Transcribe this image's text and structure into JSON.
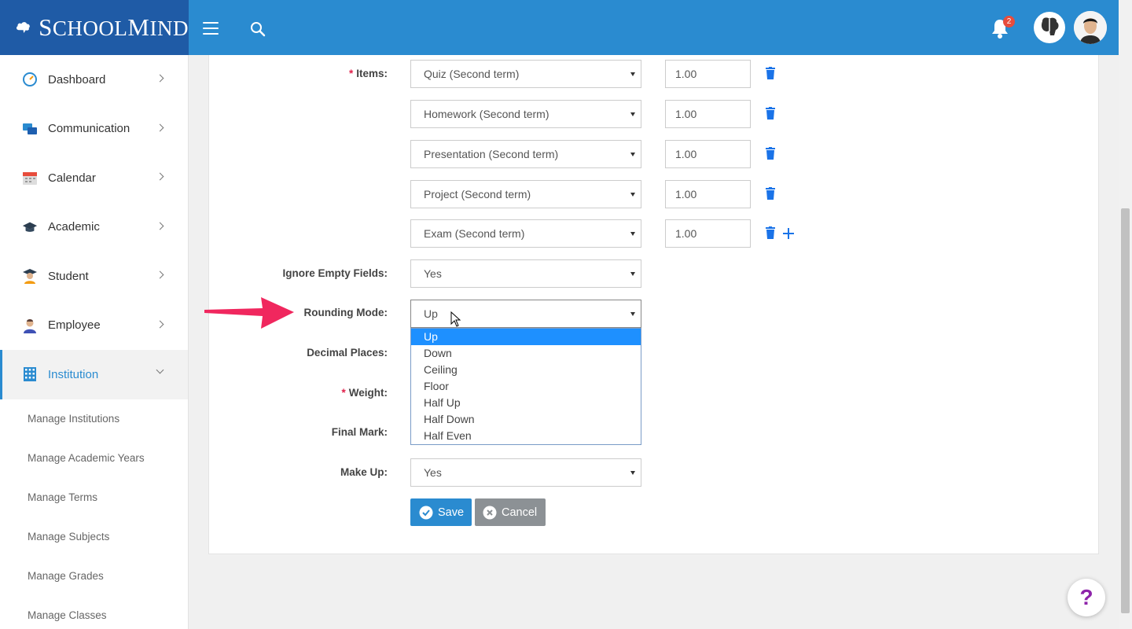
{
  "header": {
    "logo_text_first": "S",
    "logo_text_rest": "CHOOL",
    "logo_text_second": "M",
    "logo_text_second_rest": "IND",
    "notification_count": "2"
  },
  "sidebar": {
    "items": [
      {
        "label": "Dashboard",
        "icon": "dashboard-icon"
      },
      {
        "label": "Communication",
        "icon": "chat-icon"
      },
      {
        "label": "Calendar",
        "icon": "calendar-icon"
      },
      {
        "label": "Academic",
        "icon": "graduation-cap-icon"
      },
      {
        "label": "Student",
        "icon": "student-icon"
      },
      {
        "label": "Employee",
        "icon": "employee-icon"
      },
      {
        "label": "Institution",
        "icon": "building-icon"
      }
    ],
    "sub_items": [
      "Manage Institutions",
      "Manage Academic Years",
      "Manage Terms",
      "Manage Subjects",
      "Manage Grades",
      "Manage Classes"
    ]
  },
  "form": {
    "items_label": "Items:",
    "items": [
      {
        "name": "Quiz (Second term)",
        "value": "1.00"
      },
      {
        "name": "Homework (Second term)",
        "value": "1.00"
      },
      {
        "name": "Presentation (Second term)",
        "value": "1.00"
      },
      {
        "name": "Project (Second term)",
        "value": "1.00"
      },
      {
        "name": "Exam (Second term)",
        "value": "1.00"
      }
    ],
    "ignore_empty_label": "Ignore Empty Fields:",
    "ignore_empty_value": "Yes",
    "rounding_label": "Rounding Mode:",
    "rounding_value": "Up",
    "rounding_options": [
      "Up",
      "Down",
      "Ceiling",
      "Floor",
      "Half Up",
      "Half Down",
      "Half Even"
    ],
    "decimal_label": "Decimal Places:",
    "weight_label": "Weight:",
    "final_mark_label": "Final Mark:",
    "make_up_label": "Make Up:",
    "make_up_value": "Yes",
    "save_label": "Save",
    "cancel_label": "Cancel"
  },
  "help": {
    "label": "?"
  },
  "colors": {
    "header": "#2a8bd0",
    "logo_bg": "#1f5ba6",
    "accent": "#2a8bd0",
    "required": "#e0204a",
    "trash": "#1a73e8",
    "arrow": "#f0275e"
  }
}
